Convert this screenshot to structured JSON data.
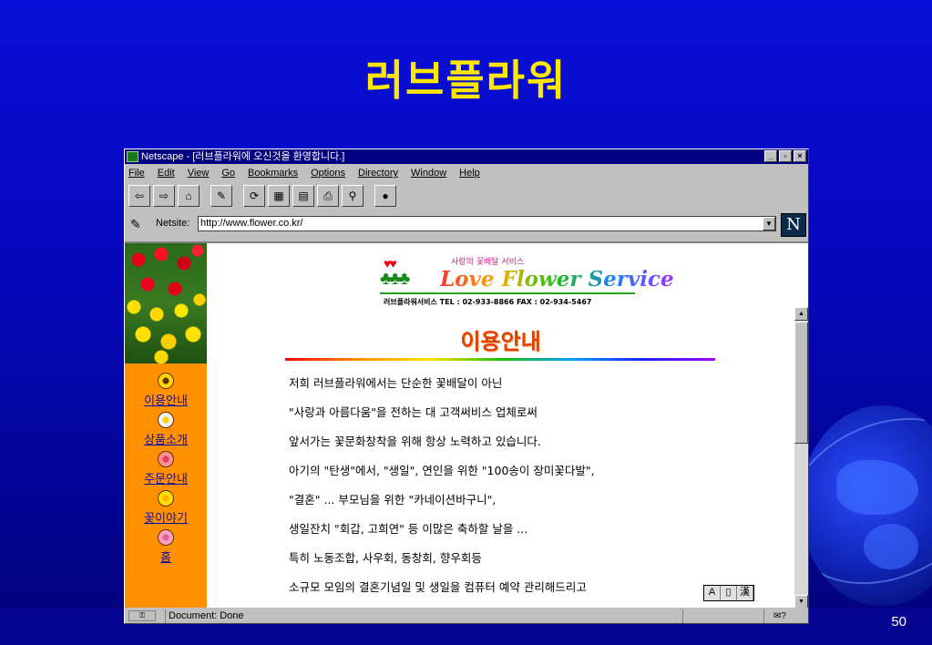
{
  "slide": {
    "title": "러브플라워",
    "page_number": "50"
  },
  "window": {
    "title": "Netscape - [러브플라워에 오신것을 환영합니다.]",
    "buttons": [
      "_",
      "▫",
      "×"
    ]
  },
  "menu": [
    "File",
    "Edit",
    "View",
    "Go",
    "Bookmarks",
    "Options",
    "Directory",
    "Window",
    "Help"
  ],
  "toolbar": {
    "icons": [
      "back-icon",
      "forward-icon",
      "home-icon",
      "edit-icon",
      "reload-icon",
      "images-icon",
      "open-icon",
      "print-icon",
      "find-icon",
      "stop-icon"
    ],
    "glyphs": [
      "⇦",
      "⇨",
      "⌂",
      "✎",
      "⟳",
      "▦",
      "▤",
      "⎙",
      "⚲",
      "●"
    ]
  },
  "location": {
    "label": "Netsite:",
    "url": "http://www.flower.co.kr/"
  },
  "sidebar": {
    "items": [
      {
        "label": "이용안내",
        "color": "#ffd800"
      },
      {
        "label": "상품소개",
        "color": "#f0f0f0"
      },
      {
        "label": "주문안내",
        "color": "#ff9090"
      },
      {
        "label": "꽃이야기",
        "color": "#ffe000"
      },
      {
        "label": "홈",
        "color": "#ffa0c0"
      }
    ]
  },
  "logo": {
    "subtitle": "사랑의 꽃배달 서비스",
    "name": "Love Flower Service",
    "contact": "러브플라워서비스 TEL : 02-933-8866 FAX : 02-934-5467"
  },
  "main": {
    "heading": "이용안내",
    "lines": [
      "저희 러브플라워에서는 단순한 꽃배달이 아닌",
      "\"사랑과 아름다움\"을 전하는 대 고객써비스 업체로써",
      "앞서가는 꽃문화창착을 위해 항상 노력하고 있습니다.",
      "아기의 \"탄생\"에서, \"생일\", 연인을 위한 \"100송이 장미꽃다발\",",
      "\"결혼\" ... 부모님을 위한 \"카네이션바구니\",",
      "생일잔치 \"회갑, 고희연\" 등 이많은 축하할 날을 ...",
      "특히 노동조합, 사우회, 동창회, 향우회등",
      "소규모 모임의 결혼기념일 및 생일을 컴퓨터 예약 관리해드리고"
    ],
    "ime": [
      "A",
      "▯",
      "漢"
    ]
  },
  "status": {
    "text": "Document: Done"
  }
}
